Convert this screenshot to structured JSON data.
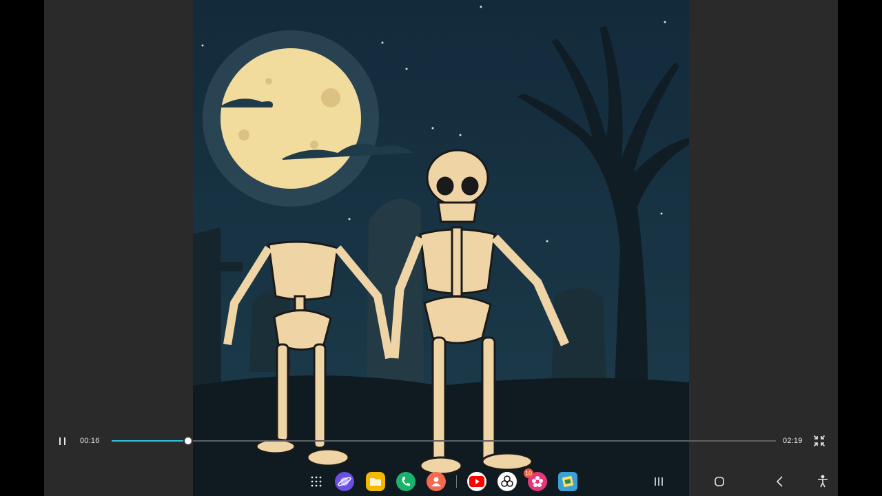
{
  "player": {
    "elapsed": "00:16",
    "duration": "02:19",
    "progress_fraction": 0.115,
    "accent_color": "#2cc6de",
    "state": "playing"
  },
  "video": {
    "scene": "two-skeletons-graveyard-night"
  },
  "taskbar": {
    "apps": [
      {
        "name": "app-drawer",
        "icon": "grid-dots-icon"
      },
      {
        "name": "samsung-internet",
        "icon": "browser-planet-icon",
        "color": "#6a4fe0"
      },
      {
        "name": "my-files",
        "icon": "folder-icon",
        "color": "#f5b800"
      },
      {
        "name": "phone",
        "icon": "phone-icon",
        "color": "#1bb36b"
      },
      {
        "name": "contacts",
        "icon": "person-icon",
        "color": "#f46a4f"
      },
      {
        "name": "youtube",
        "icon": "youtube-icon",
        "color": "#ff0000"
      },
      {
        "name": "chatgpt",
        "icon": "chatgpt-icon",
        "color": "#ffffff"
      },
      {
        "name": "blossom-app",
        "icon": "flower-icon",
        "color": "#e8367b"
      },
      {
        "name": "photo-app",
        "icon": "picture-book-icon",
        "color": "#3aa0d8"
      }
    ],
    "youtube_badge": "10",
    "nav": [
      "recent-apps-icon",
      "home-icon",
      "back-icon",
      "accessibility-icon"
    ]
  }
}
